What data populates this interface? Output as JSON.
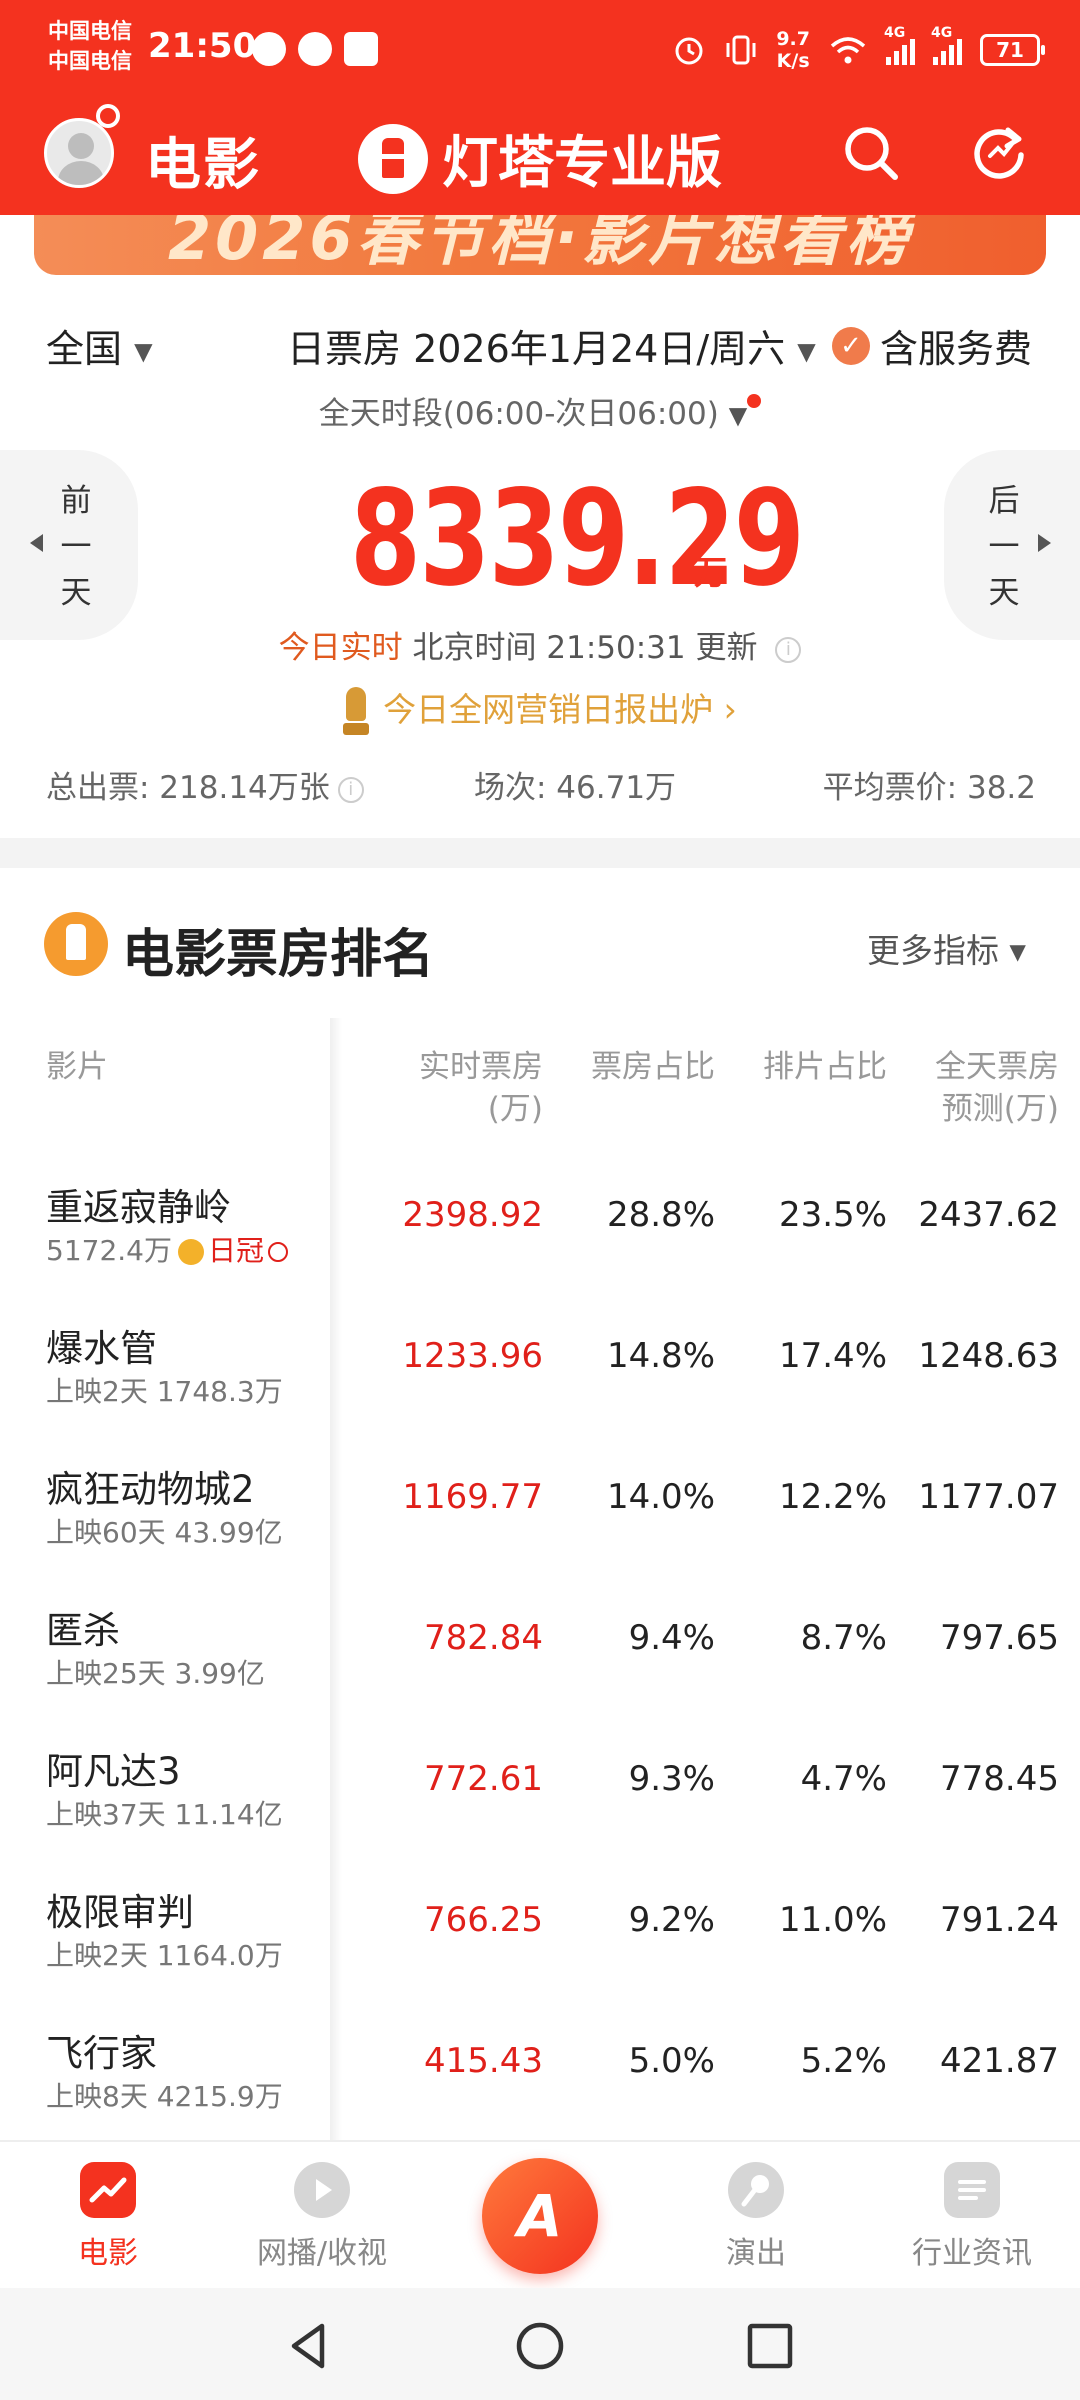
{
  "status": {
    "carrier1": "中国电信",
    "carrier2": "中国电信",
    "time": "21:50",
    "net_speed_value": "9.7",
    "net_speed_unit": "K/s",
    "net1": "4G",
    "net2": "4G",
    "battery": "71"
  },
  "nav": {
    "title": "电影",
    "brand": "灯塔专业版"
  },
  "banner": {
    "text": "2026春节档·影片想看榜"
  },
  "filters": {
    "region": "全国",
    "date": "日票房 2026年1月24日/周六",
    "service_fee": "含服务费",
    "period": "全天时段(06:00-次日06:00)"
  },
  "day_nav": {
    "prev": "前一天",
    "next": "后一天"
  },
  "box_office": {
    "value": "8339.29",
    "unit": "万",
    "realtime_label": "今日实时",
    "update_text": "北京时间 21:50:31 更新",
    "report_link": "今日全网营销日报出炉 ›"
  },
  "summary": {
    "tickets": "总出票: 218.14万张",
    "shows": "场次: 46.71万",
    "avg_price": "平均票价: 38.2"
  },
  "ranking": {
    "title": "电影票房排名",
    "more": "更多指标 ▾",
    "columns": {
      "film": "影片",
      "realtime_l1": "实时票房",
      "realtime_l2": "(万)",
      "share": "票房占比",
      "schedule": "排片占比",
      "forecast_l1": "全天票房",
      "forecast_l2": "预测(万)"
    },
    "rows": [
      {
        "name": "重返寂静岭",
        "sub": "5172.4万",
        "badge": "日冠",
        "realtime": "2398.92",
        "share": "28.8%",
        "schedule": "23.5%",
        "forecast": "2437.62"
      },
      {
        "name": "爆水管",
        "sub": "上映2天 1748.3万",
        "realtime": "1233.96",
        "share": "14.8%",
        "schedule": "17.4%",
        "forecast": "1248.63"
      },
      {
        "name": "疯狂动物城2",
        "sub": "上映60天 43.99亿",
        "realtime": "1169.77",
        "share": "14.0%",
        "schedule": "12.2%",
        "forecast": "1177.07"
      },
      {
        "name": "匿杀",
        "sub": "上映25天 3.99亿",
        "realtime": "782.84",
        "share": "9.4%",
        "schedule": "8.7%",
        "forecast": "797.65"
      },
      {
        "name": "阿凡达3",
        "sub": "上映37天 11.14亿",
        "realtime": "772.61",
        "share": "9.3%",
        "schedule": "4.7%",
        "forecast": "778.45"
      },
      {
        "name": "极限审判",
        "sub": "上映2天 1164.0万",
        "realtime": "766.25",
        "share": "9.2%",
        "schedule": "11.0%",
        "forecast": "791.24"
      },
      {
        "name": "飞行家",
        "sub": "上映8天 4215.9万",
        "realtime": "415.43",
        "share": "5.0%",
        "schedule": "5.2%",
        "forecast": "421.87"
      }
    ]
  },
  "tabs": {
    "movie": "电影",
    "stream": "网播/收视",
    "show": "演出",
    "news": "行业资讯"
  },
  "colors": {
    "accent": "#f4321f",
    "realtime_value": "#e0201a",
    "highlight": "#e0a13a"
  }
}
